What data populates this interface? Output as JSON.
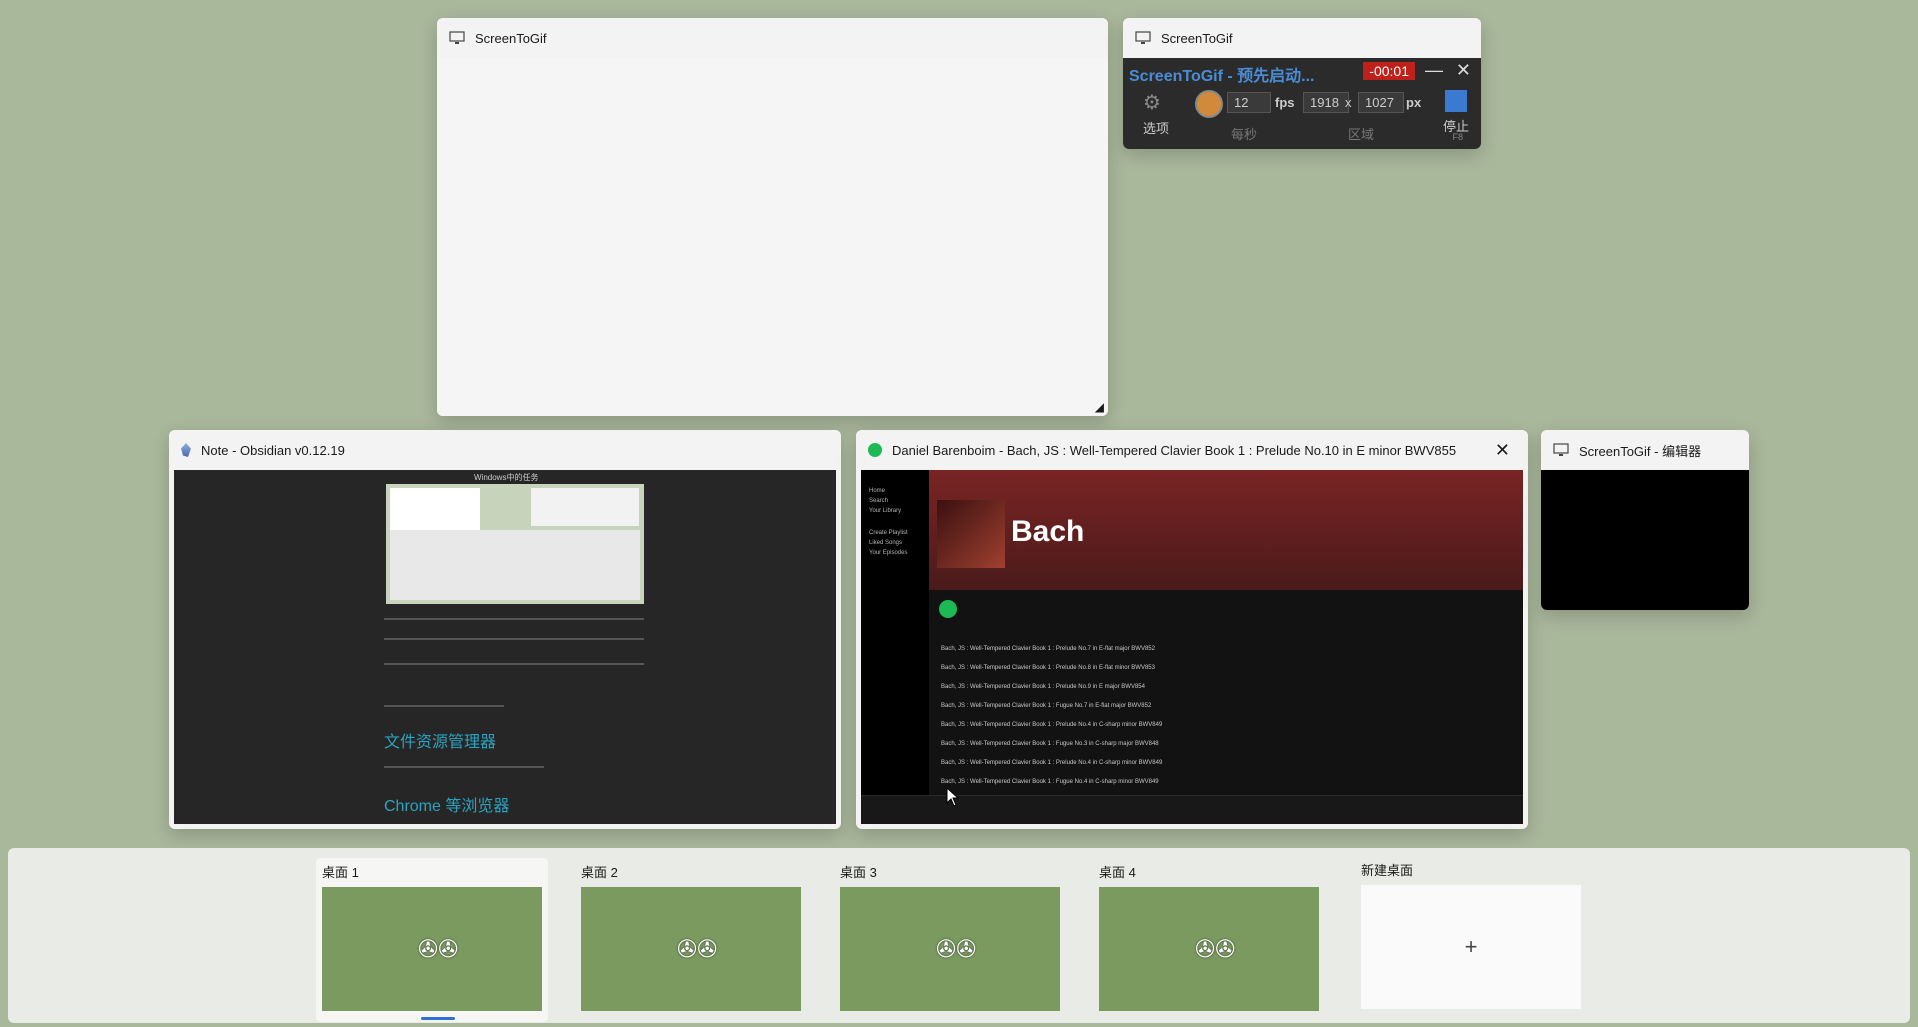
{
  "windows": {
    "stg_large": {
      "title": "ScreenToGif"
    },
    "stg_recorder": {
      "title": "ScreenToGif",
      "app_title": "ScreenToGif - 预先启动...",
      "timer": "-00:01",
      "options_label": "选项",
      "fps_value": "12",
      "fps_unit": "fps",
      "width_value": "1918",
      "x_sep": "x",
      "height_value": "1027",
      "px_unit": "px",
      "per_second": "每秒",
      "region": "区域",
      "stop_label": "停止",
      "stop_key": "F8"
    },
    "obsidian": {
      "title": "Note - Obsidian v0.12.19",
      "doc_heading": "Windows中的任务",
      "h_explorer": "文件资源管理器",
      "h_chrome": "Chrome 等浏览器"
    },
    "spotify": {
      "title": "Daniel Barenboim - Bach, JS : Well-Tempered Clavier Book 1 : Prelude No.10 in E minor BWV855",
      "album_title": "Bach",
      "nav": [
        "Home",
        "Search",
        "Your Library",
        "Create Playlist",
        "Liked Songs",
        "Your Episodes"
      ],
      "tracks": [
        "Bach, JS : Well-Tempered Clavier Book 1 : Prelude No.7 in E-flat major BWV852",
        "Bach, JS : Well-Tempered Clavier Book 1 : Prelude No.8 in E-flat minor BWV853",
        "Bach, JS : Well-Tempered Clavier Book 1 : Prelude No.9 in E major BWV854",
        "Bach, JS : Well-Tempered Clavier Book 1 : Fugue No.7 in E-flat major BWV852",
        "Bach, JS : Well-Tempered Clavier Book 1 : Prelude No.4 in C-sharp minor BWV849",
        "Bach, JS : Well-Tempered Clavier Book 1 : Fugue No.3 in C-sharp major BWV848",
        "Bach, JS : Well-Tempered Clavier Book 1 : Prelude No.4 in C-sharp minor BWV849",
        "Bach, JS : Well-Tempered Clavier Book 1 : Fugue No.4 in C-sharp minor BWV849"
      ]
    },
    "stg_editor": {
      "title": "ScreenToGif - 编辑器"
    }
  },
  "desktops": [
    {
      "label": "桌面 1",
      "active": true
    },
    {
      "label": "桌面 2",
      "active": false
    },
    {
      "label": "桌面 3",
      "active": false
    },
    {
      "label": "桌面 4",
      "active": false
    }
  ],
  "new_desktop": {
    "label": "新建桌面",
    "plus": "+"
  },
  "colors": {
    "desktop_bg": "#a9b79b",
    "wallpaper_green": "#7a9a5f",
    "spotify_green": "#1db954",
    "accent_blue": "#2f6fd6"
  }
}
